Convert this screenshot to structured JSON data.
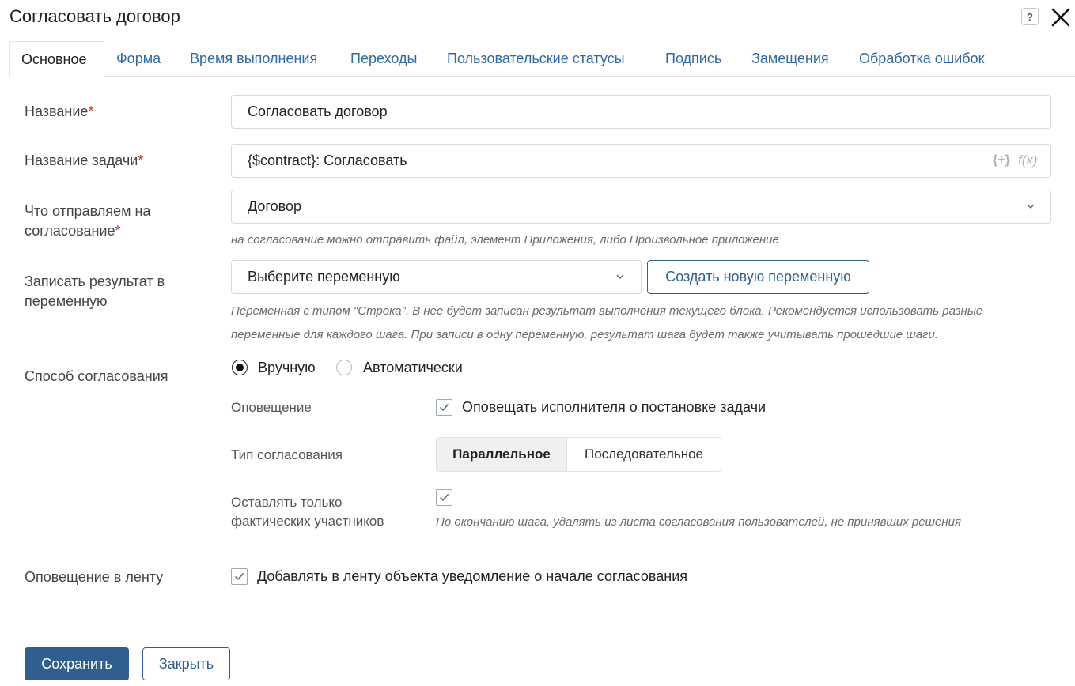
{
  "dialog": {
    "title": "Согласовать договор",
    "help_icon_text": "?"
  },
  "tabs": [
    {
      "label": "Основное",
      "active": true
    },
    {
      "label": "Форма"
    },
    {
      "label": "Время выполнения"
    },
    {
      "label": "Переходы"
    },
    {
      "label": "Пользовательские статусы"
    },
    {
      "label": "Подпись"
    },
    {
      "label": "Замещения"
    },
    {
      "label": "Обработка ошибок"
    }
  ],
  "form": {
    "name": {
      "label": "Название",
      "required_mark": "*",
      "value": "Согласовать договор"
    },
    "task_name": {
      "label": "Название задачи",
      "required_mark": "*",
      "value": "{$contract}: Согласовать",
      "insert_icon_text": "{+}",
      "function_icon_text": "f(x)"
    },
    "approval_object": {
      "label_line1": "Что отправляем на",
      "label_line2": "согласование",
      "required_mark": "*",
      "value": "Договор",
      "hint": "на согласование можно отправить файл, элемент Приложения, либо Произвольное приложение"
    },
    "result_variable": {
      "label_line1": "Записать результат в",
      "label_line2": "переменную",
      "placeholder": "Выберите переменную",
      "create_button": "Создать новую переменную",
      "hint_line1": "Переменная с типом \"Строка\". В нее будет записан результат выполнения текущего блока. Рекомендуется использовать разные",
      "hint_line2": "переменные для каждого шага. При записи в одну переменную, результат шага будет также учитывать прошедшие шаги."
    },
    "approval_method": {
      "label": "Способ согласования",
      "options": [
        {
          "label": "Вручную",
          "selected": true
        },
        {
          "label": "Автоматически",
          "selected": false
        }
      ],
      "notification": {
        "label": "Оповещение",
        "checkbox_label": "Оповещать исполнителя о постановке задачи",
        "checked": true
      },
      "approval_type": {
        "label": "Тип согласования",
        "options": [
          {
            "label": "Параллельное",
            "selected": true
          },
          {
            "label": "Последовательное",
            "selected": false
          }
        ]
      },
      "actual_participants": {
        "label_line1": "Оставлять только",
        "label_line2": "фактических участников",
        "checked": true,
        "hint": "По окончанию шага, удалять из листа согласования пользователей, не принявших решения"
      }
    },
    "feed_notification": {
      "label": "Оповещение в ленту",
      "checkbox_label": "Добавлять в ленту объекта уведомление о начале согласования",
      "checked": true
    }
  },
  "footer": {
    "save_button": "Сохранить",
    "close_button": "Закрыть"
  },
  "colors": {
    "accent": "#2f5e8f",
    "tab_link": "#2f6aa6",
    "required": "#c0392b"
  }
}
